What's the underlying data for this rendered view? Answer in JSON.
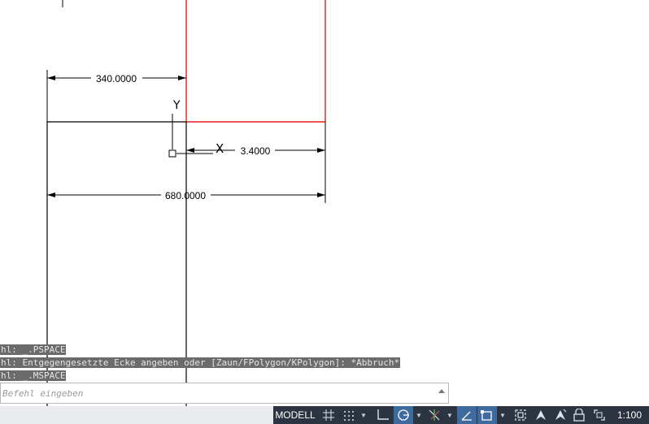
{
  "drawing": {
    "dim_top": "340.0000",
    "dim_right": "3.4000",
    "dim_bottom": "680.0000",
    "ucs_y_label": "Y",
    "ucs_x_label": "X",
    "colors": {
      "lines": "#000000",
      "red_rect": "#e02020"
    }
  },
  "command": {
    "history": [
      "hl: _.PSPACE",
      "hl: Entgegengesetzte Ecke angeben oder [Zaun/FPolygon/KPolygon]: *Abbruch*",
      "hl: _.MSPACE"
    ],
    "placeholder": "Befehl eingeben"
  },
  "status": {
    "model_label": "MODELL",
    "scale_label": "1:100",
    "icons": [
      "grid-icon",
      "snap-icon",
      "ortho-icon",
      "polar-tracking-icon",
      "isodraft-icon",
      "object-snap-tracking-icon",
      "object-snap-icon",
      "selection-cycling-icon",
      "annotation-visibility-icon",
      "auto-scale-icon",
      "lock-ui-icon",
      "fullscreen-icon"
    ],
    "colors": {
      "bar": "#2b3440",
      "active": "#3f6a9e"
    }
  }
}
